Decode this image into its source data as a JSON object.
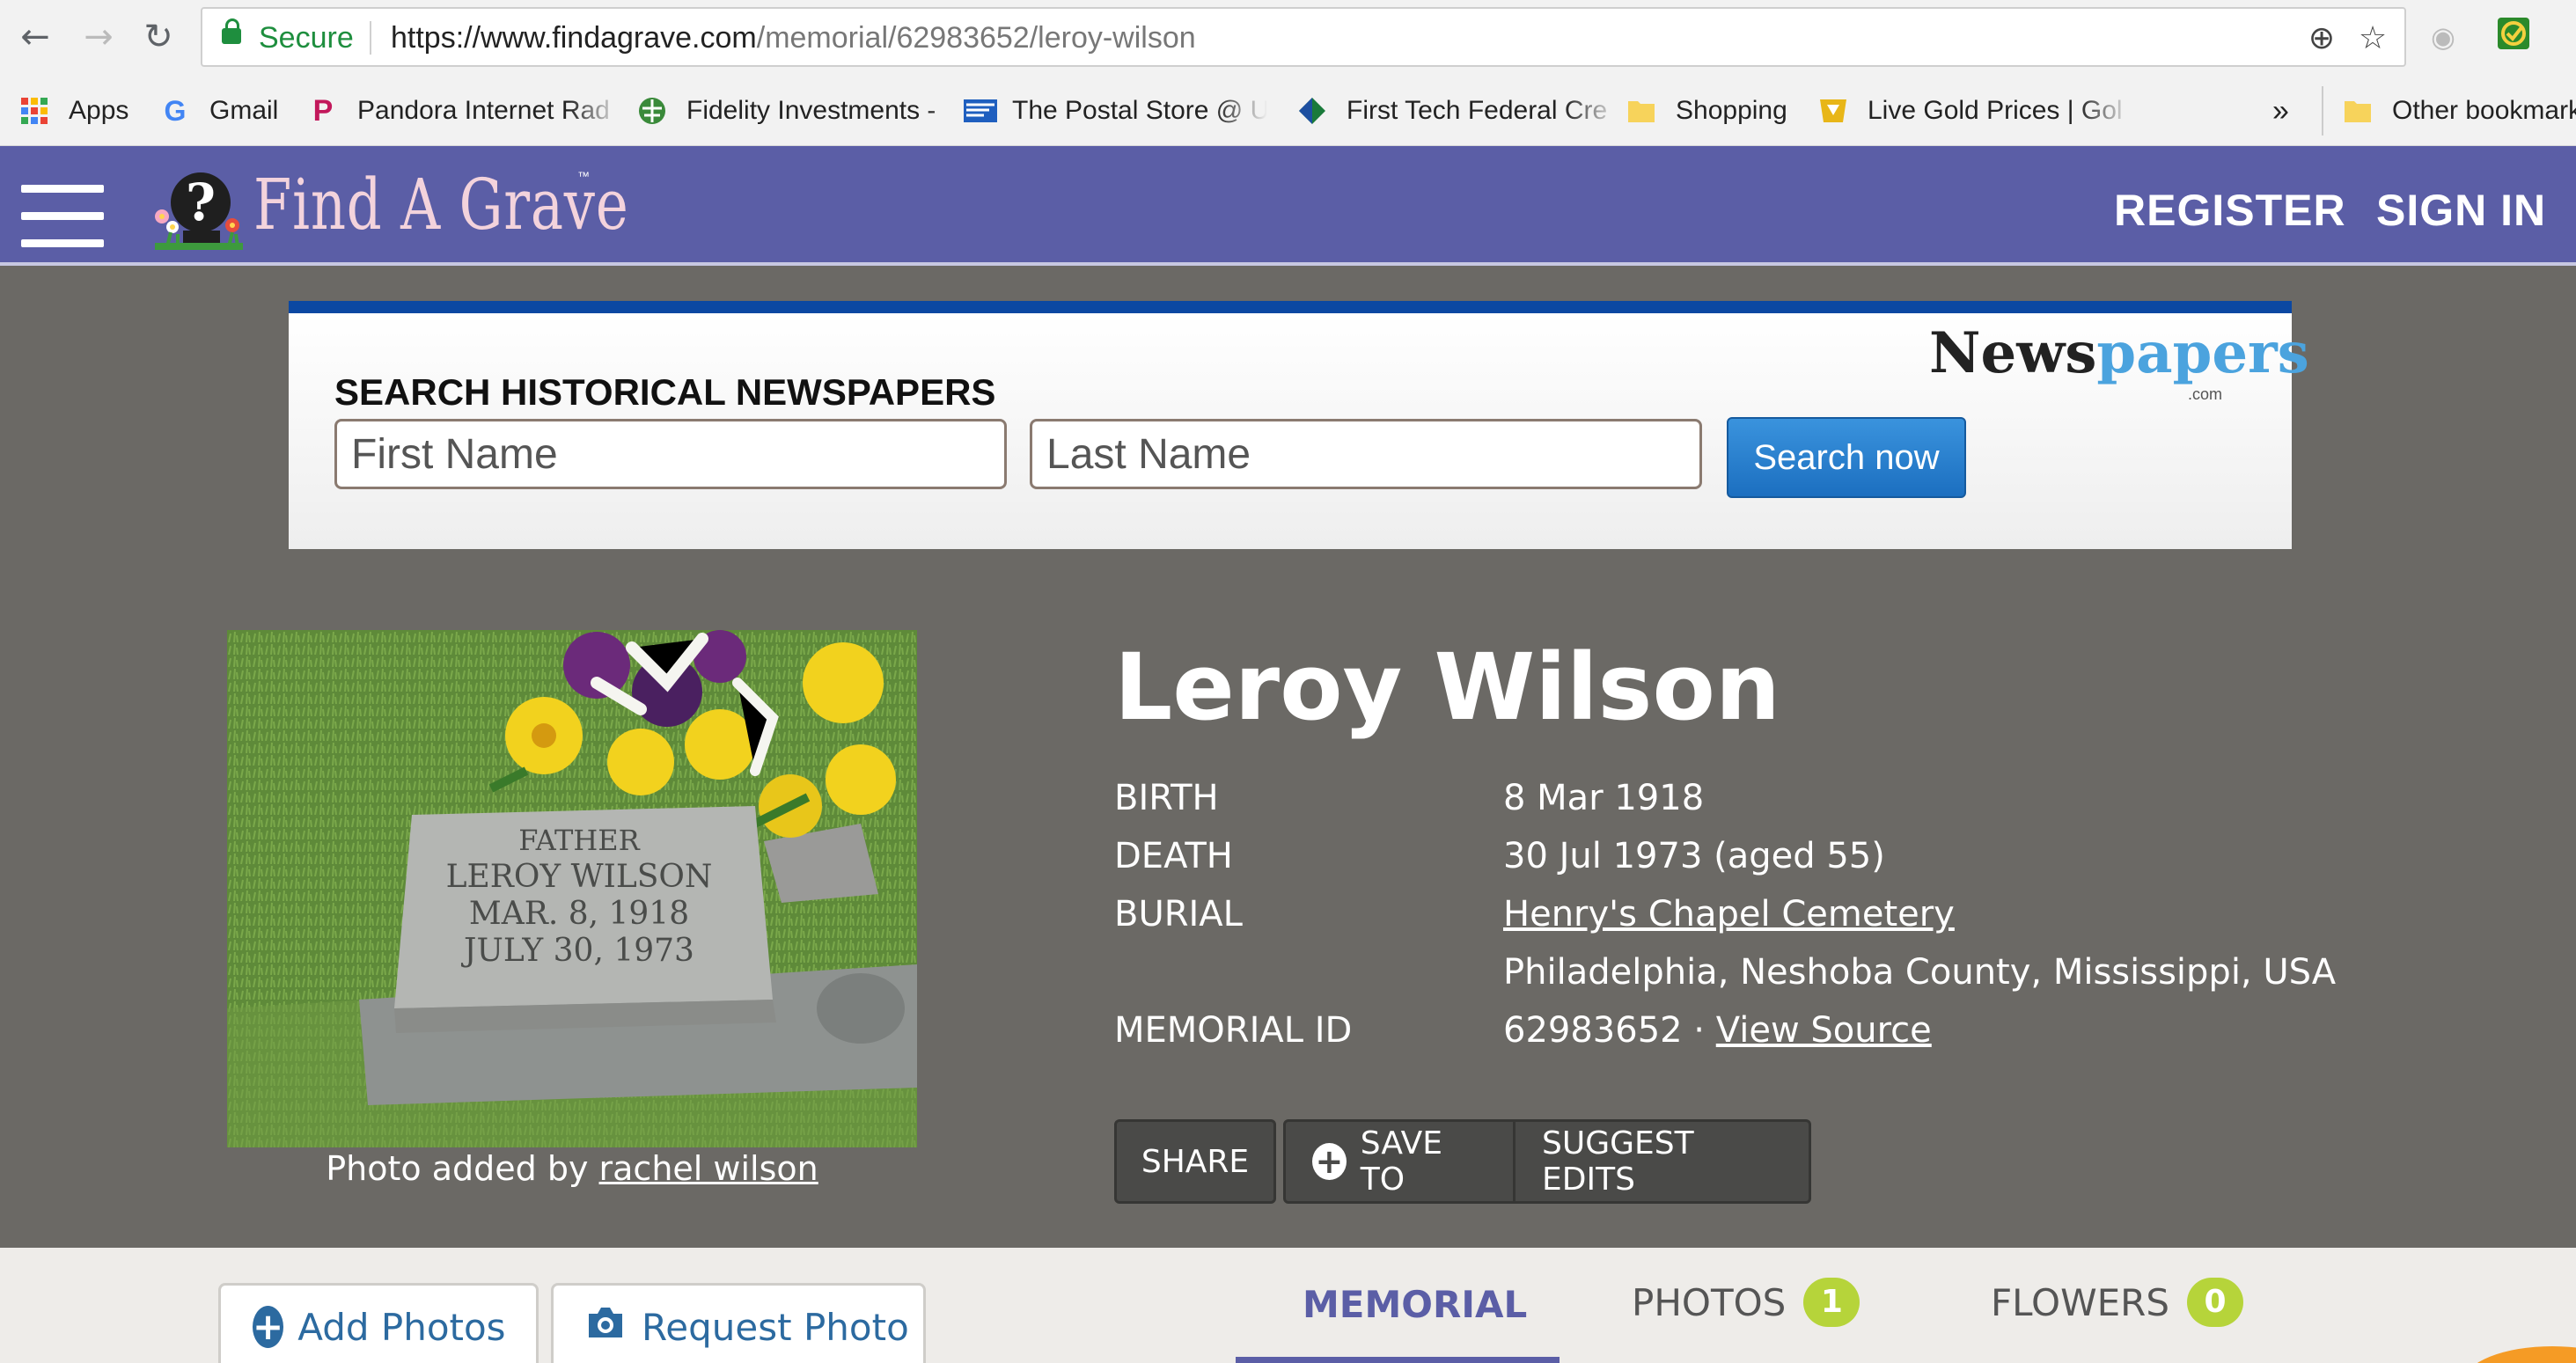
{
  "browser": {
    "secure_label": "Secure",
    "url_host": "https://www.findagrave.com",
    "url_path": "/memorial/62983652/leroy-wilson",
    "bookmarks": [
      {
        "label": "Apps",
        "icon": "apps-grid-icon"
      },
      {
        "label": "Gmail",
        "icon": "google-g-icon"
      },
      {
        "label": "Pandora Internet Rad",
        "icon": "pandora-icon"
      },
      {
        "label": "Fidelity Investments -",
        "icon": "fidelity-icon"
      },
      {
        "label": "The Postal Store @ U",
        "icon": "usps-icon"
      },
      {
        "label": "First Tech Federal Cre",
        "icon": "first-tech-icon"
      },
      {
        "label": "Shopping",
        "icon": "folder-icon"
      },
      {
        "label": "Live Gold Prices | Gol",
        "icon": "gold-icon"
      }
    ],
    "overflow_label": "»",
    "other_bookmarks": "Other bookmarks"
  },
  "header": {
    "logo_text": "Find A Grave",
    "logo_tm": "™",
    "register": "REGISTER",
    "sign_in": "SIGN IN"
  },
  "ad": {
    "title": "SEARCH HISTORICAL NEWSPAPERS",
    "first_name_placeholder": "First Name",
    "last_name_placeholder": "Last Name",
    "button": "Search now",
    "logo_a": "News",
    "logo_b": "papers",
    "logo_com": ".com"
  },
  "memorial": {
    "name": "Leroy Wilson",
    "birth_label": "BIRTH",
    "birth_value": "8 Mar 1918",
    "death_label": "DEATH",
    "death_value": "30 Jul 1973 (aged 55)",
    "burial_label": "BURIAL",
    "burial_cemetery": "Henry's Chapel Cemetery",
    "burial_location": "Philadelphia, Neshoba County, Mississippi, USA",
    "id_label": "MEMORIAL ID",
    "id_value": "62983652 · ",
    "view_source": "View Source",
    "photo_caption_prefix": "Photo added by ",
    "photo_caption_user": "rachel wilson",
    "headstone_lines": [
      "FATHER",
      "LEROY WILSON",
      "MAR. 8, 1918",
      "JULY 30, 1973"
    ]
  },
  "actions": {
    "share": "SHARE",
    "save_to": "SAVE TO",
    "suggest_edits": "SUGGEST EDITS"
  },
  "tabs": {
    "add_photos": "Add Photos",
    "request_photo": "Request Photo",
    "memorial": "MEMORIAL",
    "photos": "PHOTOS",
    "photos_count": "1",
    "flowers": "FLOWERS",
    "flowers_count": "0"
  }
}
